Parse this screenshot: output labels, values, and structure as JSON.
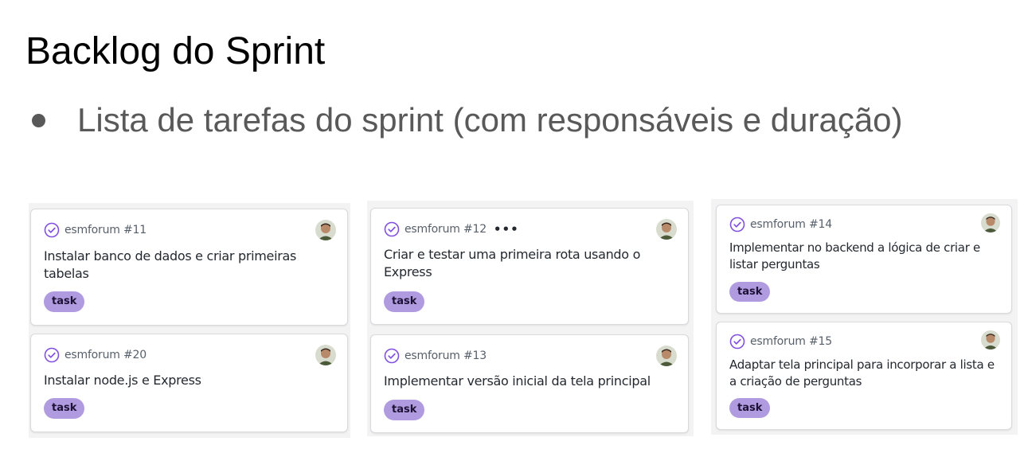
{
  "slide": {
    "title": "Backlog do Sprint",
    "bullet": "Lista de tarefas do sprint (com responsáveis e duração)"
  },
  "colors": {
    "label_bg": "#b09be0",
    "check_icon": "#8250df",
    "column_bg": "#f3f3f3",
    "bullet_text": "#595959"
  },
  "columns": [
    {
      "cards": [
        {
          "ref": "esmforum #11",
          "title_lines": [
            "Instalar banco de dados e criar primeiras",
            "tabelas"
          ],
          "label": "task",
          "icon": "issue-closed-icon"
        },
        {
          "ref": "esmforum #20",
          "title_lines": [
            "Instalar node.js e Express"
          ],
          "label": "task",
          "icon": "issue-closed-icon"
        }
      ]
    },
    {
      "cards": [
        {
          "ref": "esmforum #12",
          "title_lines": [
            "Criar e testar uma primeira rota usando o",
            "Express"
          ],
          "label": "task",
          "icon": "issue-closed-icon",
          "more": "•••"
        },
        {
          "ref": "esmforum #13",
          "title_lines": [
            "Implementar versão inicial da tela principal"
          ],
          "label": "task",
          "icon": "issue-closed-icon"
        }
      ]
    },
    {
      "cards": [
        {
          "ref": "esmforum #14",
          "title_lines": [
            "Implementar no backend a lógica de criar e",
            "listar perguntas"
          ],
          "label": "task",
          "icon": "issue-closed-icon"
        },
        {
          "ref": "esmforum #15",
          "title_lines": [
            "Adaptar tela principal para incorporar a lista e",
            "a criação de perguntas"
          ],
          "label": "task",
          "icon": "issue-closed-icon"
        }
      ]
    }
  ]
}
